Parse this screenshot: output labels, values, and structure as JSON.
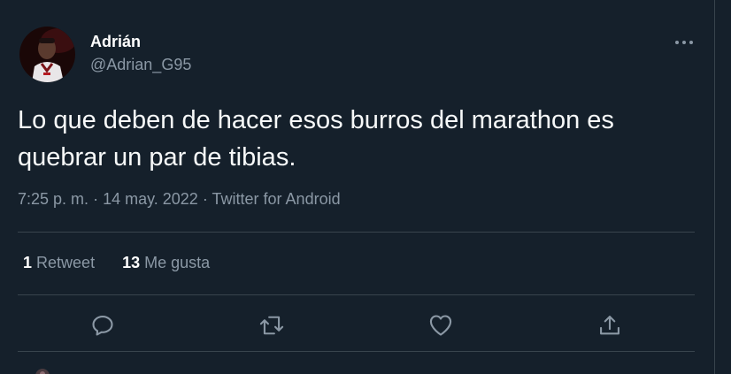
{
  "tweet": {
    "author_name": "Adrián",
    "author_handle": "@Adrian_G95",
    "avatar_icon": "user-avatar",
    "text": "Lo que deben de hacer esos burros del marathon es quebrar un par de tibias.",
    "time": "7:25 p. m.",
    "separator": "·",
    "date": "14 may. 2022",
    "source": "Twitter for Android"
  },
  "stats": {
    "retweets_count": "1",
    "retweets_label": "Retweet",
    "likes_count": "13",
    "likes_label": "Me gusta"
  },
  "actions": {
    "reply_icon": "reply-icon",
    "retweet_icon": "retweet-icon",
    "like_icon": "heart-icon",
    "share_icon": "share-icon",
    "more_icon": "more-icon"
  },
  "colors": {
    "background": "#15202b",
    "text_primary": "#ffffff",
    "text_secondary": "#8b98a5",
    "divider": "#38444d"
  }
}
